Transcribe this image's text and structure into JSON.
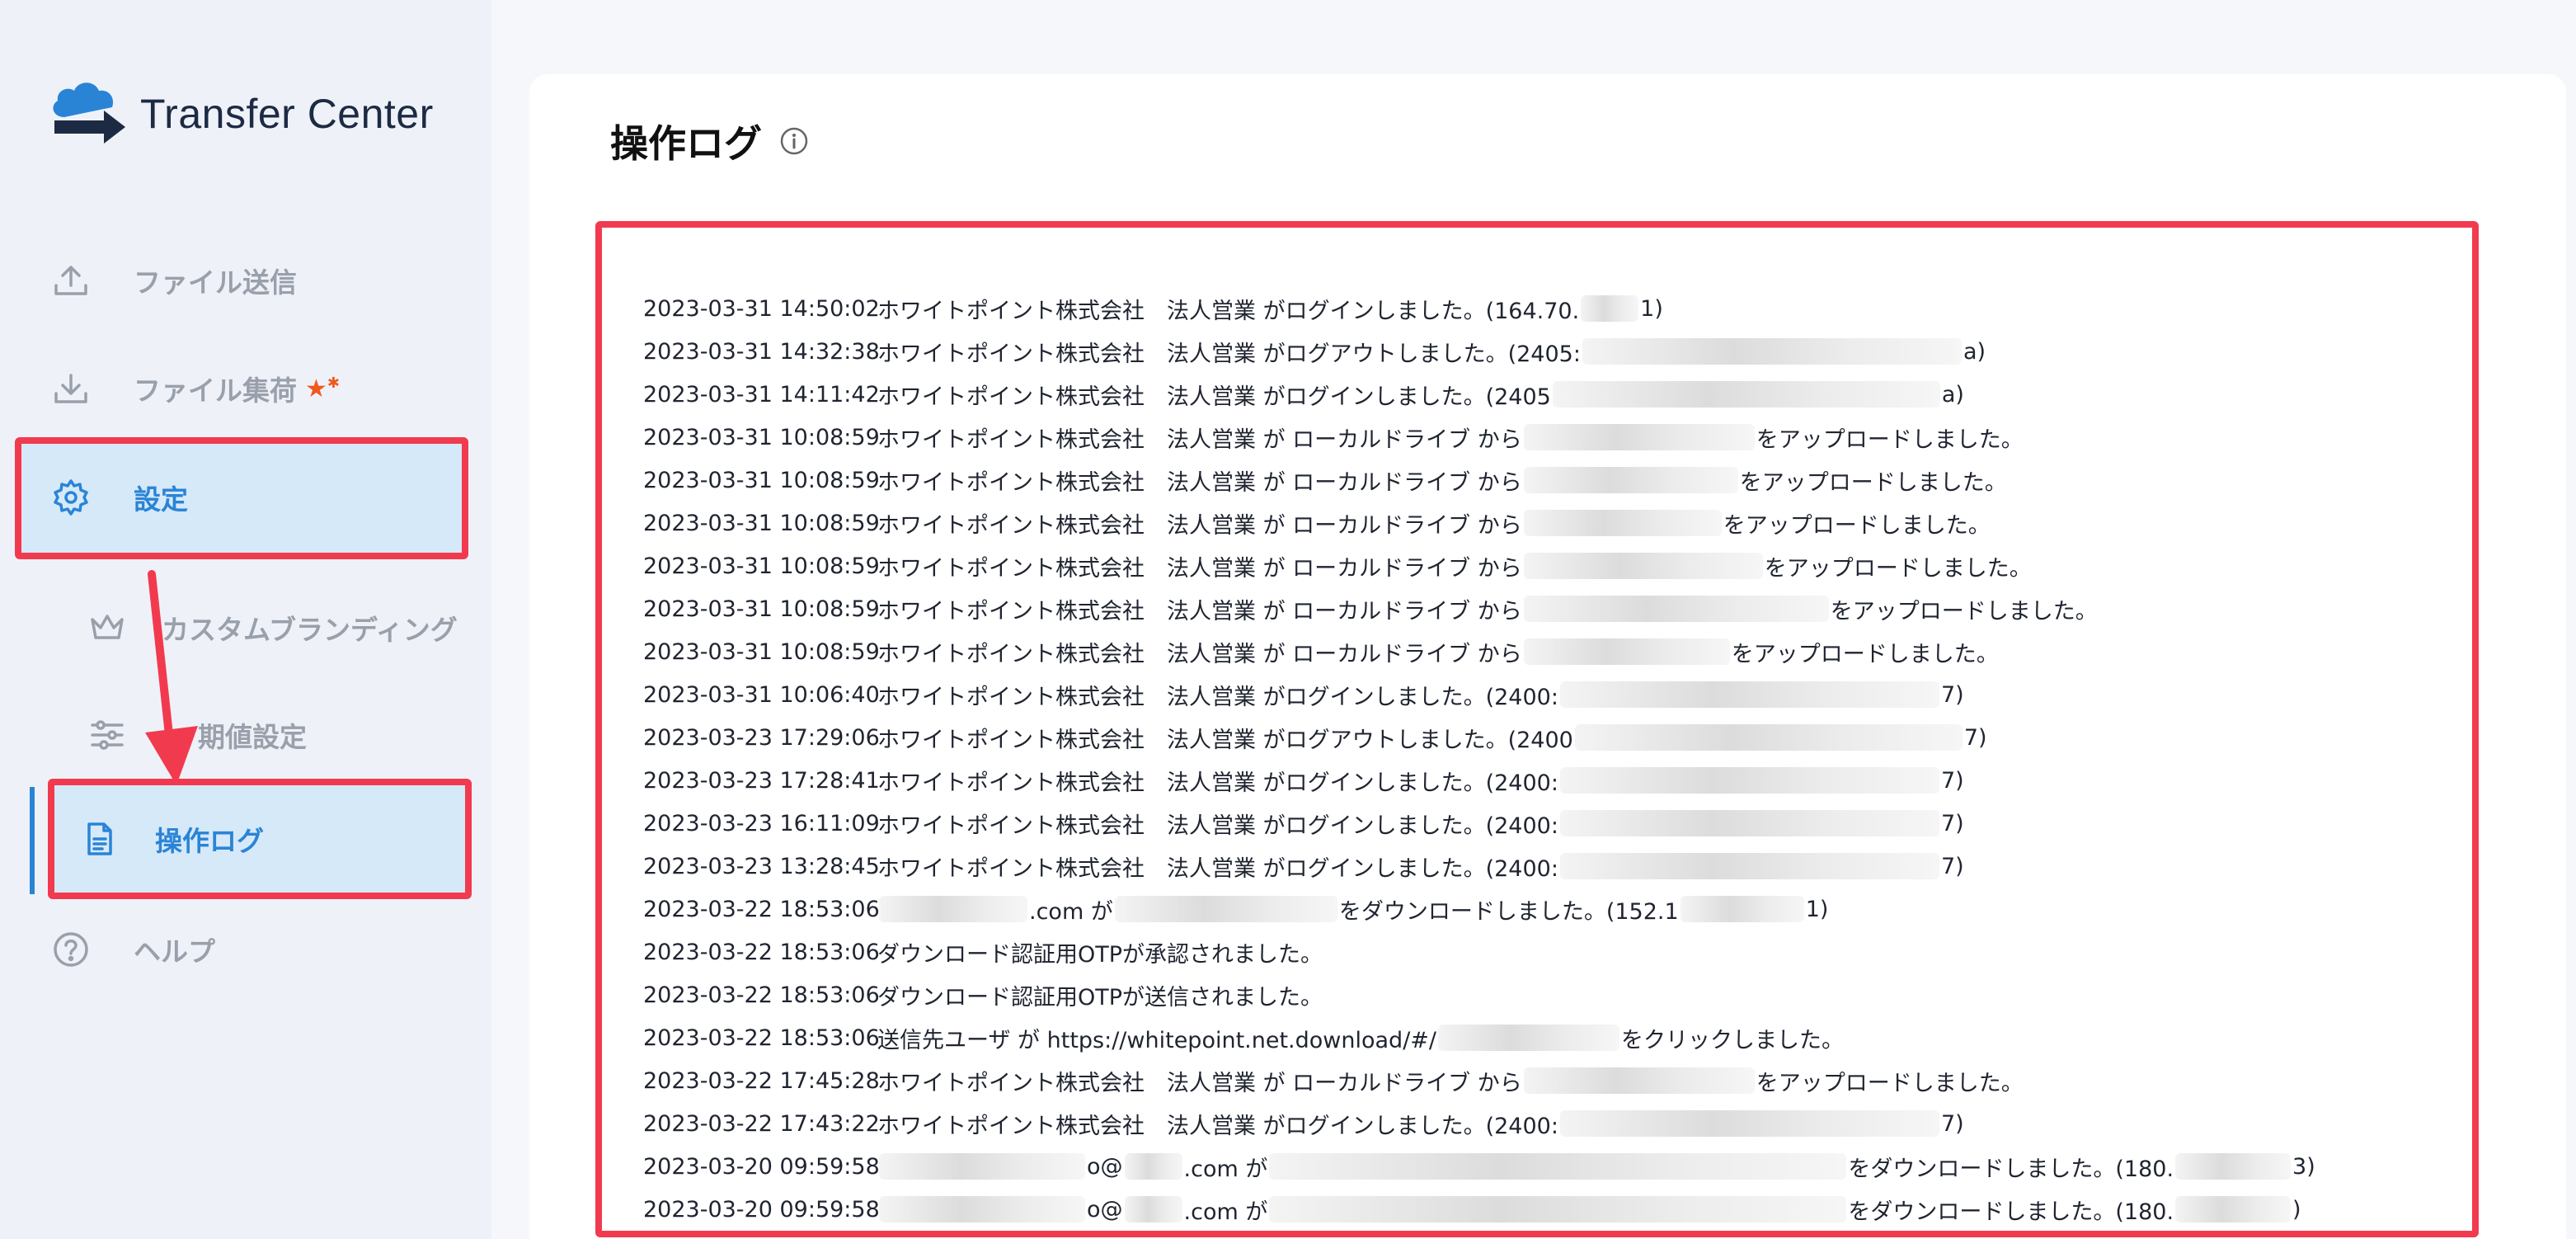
{
  "app": {
    "name": "Transfer Center"
  },
  "sidebar": {
    "items": [
      {
        "label": "ファイル送信",
        "icon": "upload-icon"
      },
      {
        "label": "ファイル集荷",
        "icon": "download-icon",
        "badge": "star-new-icon"
      },
      {
        "label": "設定",
        "icon": "gear-icon"
      },
      {
        "label": "カスタムブランディング",
        "icon": "crown-icon"
      },
      {
        "label": "期値設定",
        "icon": "sliders-icon"
      },
      {
        "label": "操作ログ",
        "icon": "document-icon"
      },
      {
        "label": "ヘルプ",
        "icon": "question-circle-icon"
      }
    ]
  },
  "main": {
    "title": "操作ログ",
    "info_icon": "info-icon",
    "logs": [
      {
        "ts": "2023-03-31 14:50:02",
        "parts": [
          "ホワイトポイント株式会社　法人営業 がログインしました。(164.70.",
          "1)"
        ]
      },
      {
        "ts": "2023-03-31 14:32:38",
        "parts": [
          "ホワイトポイント株式会社　法人営業 がログアウトしました。(2405:",
          "a)"
        ]
      },
      {
        "ts": "2023-03-31 14:11:42",
        "parts": [
          "ホワイトポイント株式会社　法人営業 がログインしました。(2405",
          "a)"
        ]
      },
      {
        "ts": "2023-03-31 10:08:59",
        "parts": [
          "ホワイトポイント株式会社　法人営業 が ローカルドライブ から",
          "をアップロードしました。"
        ]
      },
      {
        "ts": "2023-03-31 10:08:59",
        "parts": [
          "ホワイトポイント株式会社　法人営業 が ローカルドライブ から",
          "をアップロードしました。"
        ]
      },
      {
        "ts": "2023-03-31 10:08:59",
        "parts": [
          "ホワイトポイント株式会社　法人営業 が ローカルドライブ から",
          "をアップロードしました。"
        ]
      },
      {
        "ts": "2023-03-31 10:08:59",
        "parts": [
          "ホワイトポイント株式会社　法人営業 が ローカルドライブ から",
          "をアップロードしました。"
        ]
      },
      {
        "ts": "2023-03-31 10:08:59",
        "parts": [
          "ホワイトポイント株式会社　法人営業 が ローカルドライブ から",
          "をアップロードしました。"
        ]
      },
      {
        "ts": "2023-03-31 10:08:59",
        "parts": [
          "ホワイトポイント株式会社　法人営業 が ローカルドライブ から",
          "をアップロードしました。"
        ]
      },
      {
        "ts": "2023-03-31 10:06:40",
        "parts": [
          "ホワイトポイント株式会社　法人営業 がログインしました。(2400:",
          "7)"
        ]
      },
      {
        "ts": "2023-03-23 17:29:06",
        "parts": [
          "ホワイトポイント株式会社　法人営業 がログアウトしました。(2400",
          "7)"
        ]
      },
      {
        "ts": "2023-03-23 17:28:41",
        "parts": [
          "ホワイトポイント株式会社　法人営業 がログインしました。(2400:",
          "7)"
        ]
      },
      {
        "ts": "2023-03-23 16:11:09",
        "parts": [
          "ホワイトポイント株式会社　法人営業 がログインしました。(2400:",
          "7)"
        ]
      },
      {
        "ts": "2023-03-23 13:28:45",
        "parts": [
          "ホワイトポイント株式会社　法人営業 がログインしました。(2400:",
          "7)"
        ]
      },
      {
        "ts": "2023-03-22 18:53:06",
        "parts": [
          "",
          ".com が",
          "をダウンロードしました。(152.1",
          "1)"
        ]
      },
      {
        "ts": "2023-03-22 18:53:06",
        "parts": [
          "ダウンロード認証用OTPが承認されました。"
        ]
      },
      {
        "ts": "2023-03-22 18:53:06",
        "parts": [
          "ダウンロード認証用OTPが送信されました。"
        ]
      },
      {
        "ts": "2023-03-22 18:53:06",
        "parts": [
          "送信先ユーザ が https://whitepoint.net.download/#/",
          "をクリックしました。"
        ]
      },
      {
        "ts": "2023-03-22 17:45:28",
        "parts": [
          "ホワイトポイント株式会社　法人営業 が ローカルドライブ から",
          "をアップロードしました。"
        ]
      },
      {
        "ts": "2023-03-22 17:43:22",
        "parts": [
          "ホワイトポイント株式会社　法人営業 がログインしました。(2400:",
          "7)"
        ]
      },
      {
        "ts": "2023-03-20 09:59:58",
        "parts": [
          "",
          "o@",
          ".com が",
          "をダウンロードしました。(180.",
          "3)"
        ]
      },
      {
        "ts": "2023-03-20 09:59:58",
        "parts": [
          "",
          "o@",
          ".com が",
          "をダウンロードしました。(180.",
          ")"
        ]
      }
    ]
  },
  "colors": {
    "accent": "#2a84d6",
    "highlight_border": "#f23a4f",
    "highlight_fill": "#d6e9f8",
    "muted": "#9aa0ab"
  }
}
